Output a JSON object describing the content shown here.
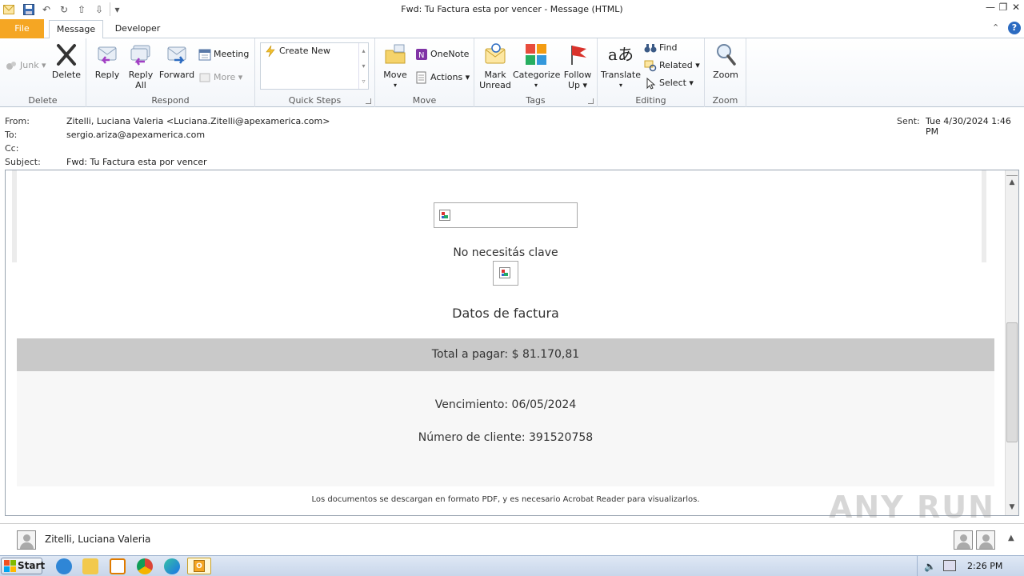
{
  "window": {
    "title": "Fwd: Tu Factura esta por vencer  -  Message (HTML)"
  },
  "tabs": {
    "file": "File",
    "message": "Message",
    "developer": "Developer"
  },
  "ribbon": {
    "delete_group": {
      "label": "Delete",
      "junk": "Junk",
      "delete": "Delete"
    },
    "respond_group": {
      "label": "Respond",
      "reply": "Reply",
      "reply_all_1": "Reply",
      "reply_all_2": "All",
      "forward": "Forward",
      "meeting": "Meeting",
      "more": "More"
    },
    "quicksteps_group": {
      "label": "Quick Steps",
      "create_new": "Create New"
    },
    "move_group": {
      "label": "Move",
      "move": "Move",
      "onenote": "OneNote",
      "actions": "Actions"
    },
    "tags_group": {
      "label": "Tags",
      "mark_unread_1": "Mark",
      "mark_unread_2": "Unread",
      "categorize": "Categorize",
      "follow_up_1": "Follow",
      "follow_up_2": "Up"
    },
    "editing_group": {
      "label": "Editing",
      "translate": "Translate",
      "find": "Find",
      "related": "Related",
      "select": "Select"
    },
    "zoom_group": {
      "label": "Zoom",
      "zoom": "Zoom"
    }
  },
  "header": {
    "from_label": "From:",
    "from_value": "Zitelli, Luciana Valeria <Luciana.Zitelli@apexamerica.com>",
    "to_label": "To:",
    "to_value": "sergio.ariza@apexamerica.com",
    "cc_label": "Cc:",
    "subject_label": "Subject:",
    "subject_value": "Fwd: Tu Factura esta por vencer",
    "sent_label": "Sent:",
    "sent_value": "Tue 4/30/2024 1:46 PM"
  },
  "body": {
    "no_password": "No necesitás clave",
    "invoice_data": "Datos de factura",
    "total": "Total a pagar:  $ 81.170,81",
    "due": "Vencimiento: 06/05/2024",
    "client_number": "Número de cliente: 391520758",
    "footer_note": "Los documentos se descargan en formato PDF, y es necesario Acrobat Reader para visualizarlos."
  },
  "people_pane": {
    "name": "Zitelli, Luciana Valeria"
  },
  "taskbar": {
    "start": "Start",
    "clock": "2:26 PM"
  },
  "watermark": "ANY RUN",
  "colors": {
    "file_tab": "#f5a623",
    "total_band": "#c9c9c9",
    "body_band": "#f7f7f7"
  }
}
